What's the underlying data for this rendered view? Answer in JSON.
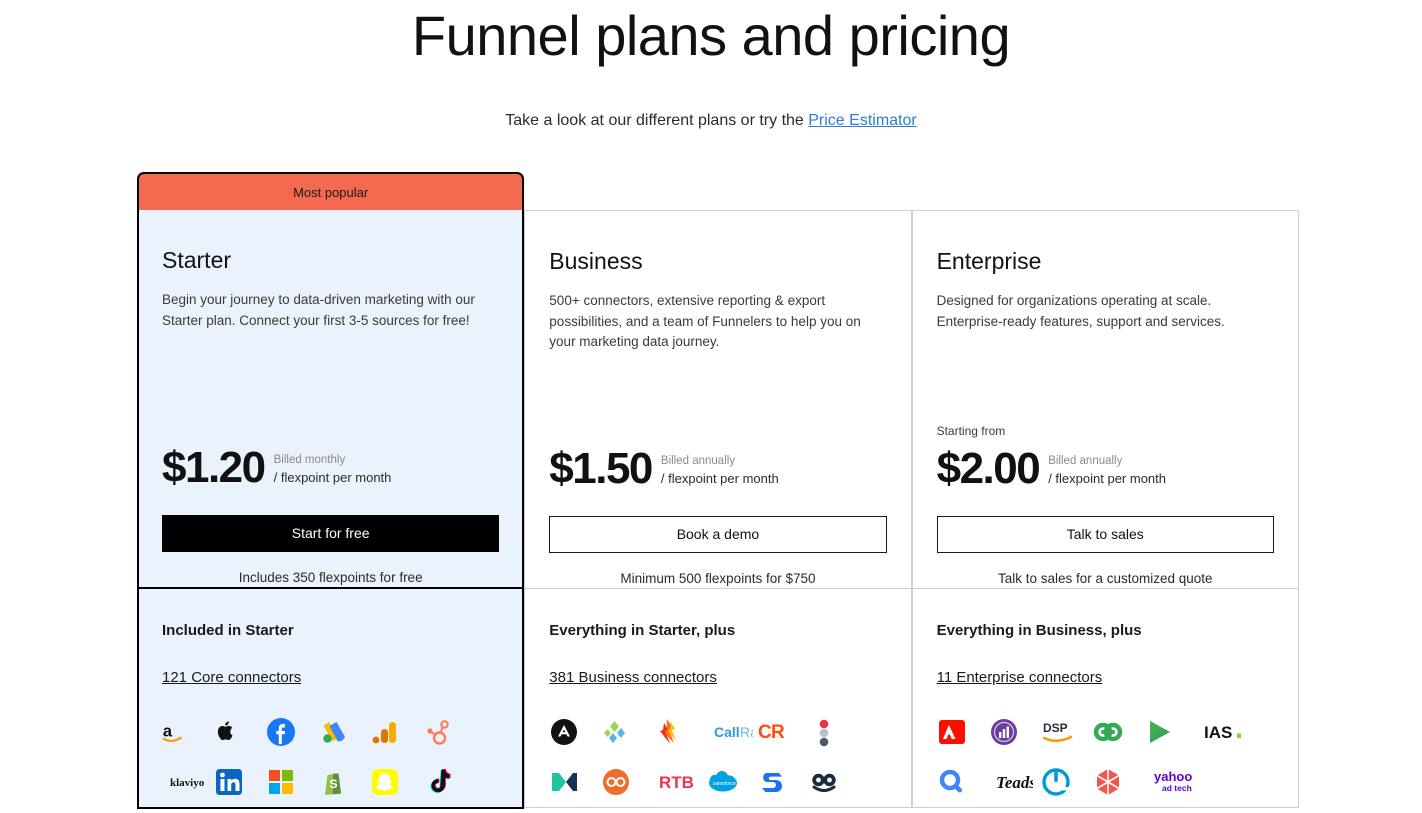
{
  "header": {
    "title": "Funnel plans and pricing",
    "subtitle_prefix": "Take a look at our different plans or try the ",
    "subtitle_link": "Price Estimator",
    "link_color": "#2b7fd4"
  },
  "badge": {
    "most_popular": "Most popular",
    "color": "#f46a50"
  },
  "plans": [
    {
      "id": "starter",
      "featured": true,
      "name": "Starter",
      "description": "Begin your journey to data-driven marketing with our Starter plan. Connect your first 3-5 sources for free!",
      "starting_from": "",
      "price": "$1.20",
      "billed": "Billed monthly",
      "per_unit": "/ flexpoint per month",
      "cta_label": "Start for free",
      "cta_style": "solid",
      "cta_note": "Includes 350 flexpoints for free",
      "included_title": "Included in Starter",
      "connector_link": "121 Core connectors",
      "logos": [
        "amazon",
        "apple",
        "facebook",
        "google-ads",
        "google-analytics",
        "hubspot",
        "klaviyo",
        "linkedin",
        "microsoft",
        "shopify",
        "snapchat",
        "tiktok"
      ]
    },
    {
      "id": "business",
      "featured": false,
      "name": "Business",
      "description": "500+ connectors, extensive reporting & export possibilities, and a team of Funnelers to help you on your marketing data journey.",
      "starting_from": "",
      "price": "$1.50",
      "billed": "Billed annually",
      "per_unit": "/ flexpoint per month",
      "cta_label": "Book a demo",
      "cta_style": "outline",
      "cta_note": "Minimum 500 flexpoints for $750",
      "included_title": "Everything in Starter, plus",
      "connector_link": "381 Business connectors",
      "logos": [
        "adjust",
        "awin",
        "braze",
        "callrail",
        "criteo",
        "dotdigital",
        "mixpanel",
        "outbrain",
        "rtb-house",
        "salesforce",
        "stackadapt",
        "taboola"
      ]
    },
    {
      "id": "enterprise",
      "featured": false,
      "name": "Enterprise",
      "description": "Designed for organizations operating at scale. Enterprise-ready features, support and services.",
      "starting_from": "Starting from",
      "price": "$2.00",
      "billed": "Billed annually",
      "per_unit": "/ flexpoint per month",
      "cta_label": "Talk to sales",
      "cta_style": "outline",
      "cta_note": "Talk to sales for a customized quote",
      "included_title": "Everything in Business, plus",
      "connector_link": "11 Enterprise connectors",
      "logos": [
        "adobe",
        "analytics-purple",
        "amazon-dsp",
        "dv360",
        "google-play",
        "ias",
        "search-ads",
        "teads",
        "the-trade-desk",
        "vidoomy",
        "yahoo-ad-tech",
        ""
      ]
    }
  ]
}
